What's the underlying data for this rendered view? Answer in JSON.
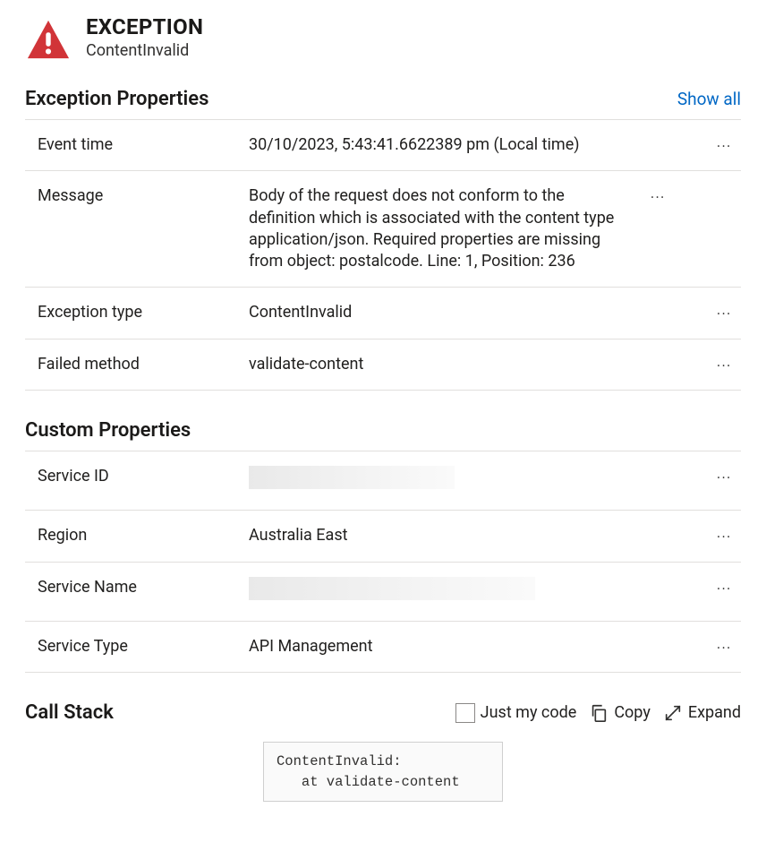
{
  "header": {
    "title": "EXCEPTION",
    "subtitle": "ContentInvalid"
  },
  "exception_section": {
    "heading": "Exception Properties",
    "show_all": "Show all",
    "rows": [
      {
        "label": "Event time",
        "value": "30/10/2023, 5:43:41.6622389 pm (Local time)"
      },
      {
        "label": "Message",
        "value": "Body of the request does not conform to the definition which is associated with the content type application/json. Required properties are missing from object: postalcode. Line: 1, Position: 236"
      },
      {
        "label": "Exception type",
        "value": "ContentInvalid"
      },
      {
        "label": "Failed method",
        "value": "validate-content"
      }
    ]
  },
  "custom_section": {
    "heading": "Custom Properties",
    "rows": [
      {
        "label": "Service ID",
        "value": "",
        "redacted": true,
        "redact_width": 230
      },
      {
        "label": "Region",
        "value": "Australia East",
        "redacted": false
      },
      {
        "label": "Service Name",
        "value": "",
        "redacted": true,
        "redact_width": 320
      },
      {
        "label": "Service Type",
        "value": "API Management",
        "redacted": false
      }
    ]
  },
  "callstack": {
    "heading": "Call Stack",
    "just_my_code": "Just my code",
    "copy": "Copy",
    "expand": "Expand",
    "trace": "ContentInvalid:\n   at validate-content"
  }
}
